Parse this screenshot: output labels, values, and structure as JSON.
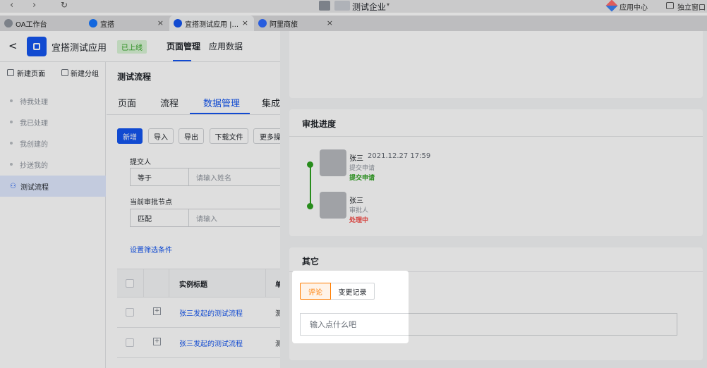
{
  "browser": {
    "company_name": "测试企业",
    "app_center_label": "应用中心",
    "standalone_window_label": "独立窗口",
    "tabs": [
      {
        "label": "OA工作台",
        "color": "#8f959e"
      },
      {
        "label": "宜搭",
        "color": "#1677ff"
      },
      {
        "label": "宜搭测试应用 |...",
        "color": "#1456f0"
      },
      {
        "label": "阿里商旅",
        "color": "#2f6bff"
      }
    ],
    "close_glyph": "×"
  },
  "app_header": {
    "back_glyph": "<",
    "app_name": "宜搭测试应用",
    "status_badge": "已上线",
    "nav_tabs": [
      {
        "label": "页面管理",
        "active": true
      },
      {
        "label": "应用数据",
        "active": false
      }
    ]
  },
  "sidebar": {
    "new_page_label": "新建页面",
    "new_group_label": "新建分组",
    "items": [
      {
        "label": "待我处理"
      },
      {
        "label": "我已处理"
      },
      {
        "label": "我创建的"
      },
      {
        "label": "抄送我的"
      },
      {
        "label": "测试流程"
      }
    ]
  },
  "center": {
    "title": "测试流程",
    "tabs": [
      "页面",
      "流程",
      "数据管理",
      "集成"
    ],
    "actions": [
      "新增",
      "导入",
      "导出",
      "下载文件",
      "更多操"
    ],
    "filters": [
      {
        "label": "提交人",
        "operator": "等于",
        "placeholder": "请输入姓名"
      },
      {
        "label": "当前审批节点",
        "operator": "匹配",
        "placeholder": "请输入"
      }
    ],
    "set_filter_link": "设置筛选条件",
    "table": {
      "headers": [
        "实例标题",
        "单"
      ],
      "rows": [
        {
          "title": "张三发起的测试流程",
          "extra": "测"
        },
        {
          "title": "张三发起的测试流程",
          "extra": "测"
        }
      ]
    }
  },
  "drawer": {
    "progress_title": "审批进度",
    "steps": [
      {
        "name": "张三",
        "time": "2021.12.27 17:59",
        "role": "提交申请",
        "status": "提交申请",
        "status_color": "#2ea121"
      },
      {
        "name": "张三",
        "time": "",
        "role": "审批人",
        "status": "处理中",
        "status_color": "#f54a45"
      }
    ],
    "other_title": "其它",
    "other_tabs": [
      {
        "label": "评论",
        "active": true
      },
      {
        "label": "变更记录",
        "active": false
      }
    ],
    "comment_placeholder": "输入点什么吧"
  }
}
